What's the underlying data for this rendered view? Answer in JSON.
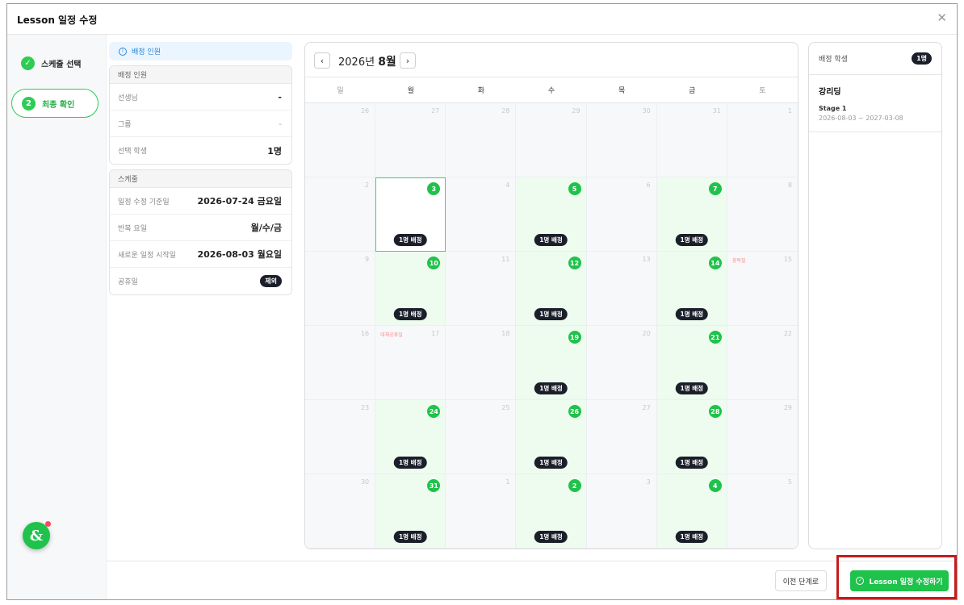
{
  "dialog": {
    "title": "Lesson 일정 수정"
  },
  "steps": [
    {
      "label": "스케줄 선택",
      "icon": "check"
    },
    {
      "label": "최종 확인",
      "num": "2"
    }
  ],
  "summary": {
    "notice": "배정 인원",
    "assign_card": {
      "head": "배정 인원",
      "rows": [
        {
          "label": "선생님",
          "value": "-"
        },
        {
          "label": "그룹",
          "value": "-"
        },
        {
          "label": "선택 학생",
          "value": "1명"
        }
      ]
    },
    "schedule_card": {
      "head": "스케줄",
      "rows": [
        {
          "label": "일정 수정 기준일",
          "value": "2026-07-24 금요일"
        },
        {
          "label": "반복 요일",
          "value": "월/수/금"
        },
        {
          "label": "새로운 일정 시작일",
          "value": "2026-08-03 월요일"
        },
        {
          "label": "공휴일",
          "value": "제외"
        }
      ]
    }
  },
  "calendar": {
    "year_label": "2026년",
    "month_label": "8월",
    "weekdays": [
      "일",
      "월",
      "화",
      "수",
      "목",
      "금",
      "토"
    ],
    "assign_label": "1명 배정",
    "weeks": [
      [
        {
          "d": "26"
        },
        {
          "d": "27"
        },
        {
          "d": "28"
        },
        {
          "d": "29"
        },
        {
          "d": "30"
        },
        {
          "d": "31"
        },
        {
          "d": "1"
        }
      ],
      [
        {
          "d": "2"
        },
        {
          "d": "3",
          "active": true,
          "sel": true
        },
        {
          "d": "4"
        },
        {
          "d": "5",
          "active": true
        },
        {
          "d": "6"
        },
        {
          "d": "7",
          "active": true
        },
        {
          "d": "8"
        }
      ],
      [
        {
          "d": "9"
        },
        {
          "d": "10",
          "active": true
        },
        {
          "d": "11"
        },
        {
          "d": "12",
          "active": true
        },
        {
          "d": "13"
        },
        {
          "d": "14",
          "active": true
        },
        {
          "d": "15",
          "holiday": "광복절"
        }
      ],
      [
        {
          "d": "16"
        },
        {
          "d": "17",
          "holiday": "대체공휴일"
        },
        {
          "d": "18"
        },
        {
          "d": "19",
          "active": true
        },
        {
          "d": "20"
        },
        {
          "d": "21",
          "active": true
        },
        {
          "d": "22"
        }
      ],
      [
        {
          "d": "23"
        },
        {
          "d": "24",
          "active": true
        },
        {
          "d": "25"
        },
        {
          "d": "26",
          "active": true
        },
        {
          "d": "27"
        },
        {
          "d": "28",
          "active": true
        },
        {
          "d": "29"
        }
      ],
      [
        {
          "d": "30"
        },
        {
          "d": "31",
          "active": true
        },
        {
          "d": "1"
        },
        {
          "d": "2",
          "active": true
        },
        {
          "d": "3"
        },
        {
          "d": "4",
          "active": true
        },
        {
          "d": "5"
        }
      ]
    ]
  },
  "students": {
    "head": "배정 학생",
    "count": "1명",
    "items": [
      {
        "name": "강리딩",
        "stage": "Stage 1",
        "range": "2026-08-03 ~ 2027-03-08"
      }
    ]
  },
  "footer": {
    "prev_label": "이전 단계로",
    "submit_label": "Lesson 일정 수정하기"
  }
}
